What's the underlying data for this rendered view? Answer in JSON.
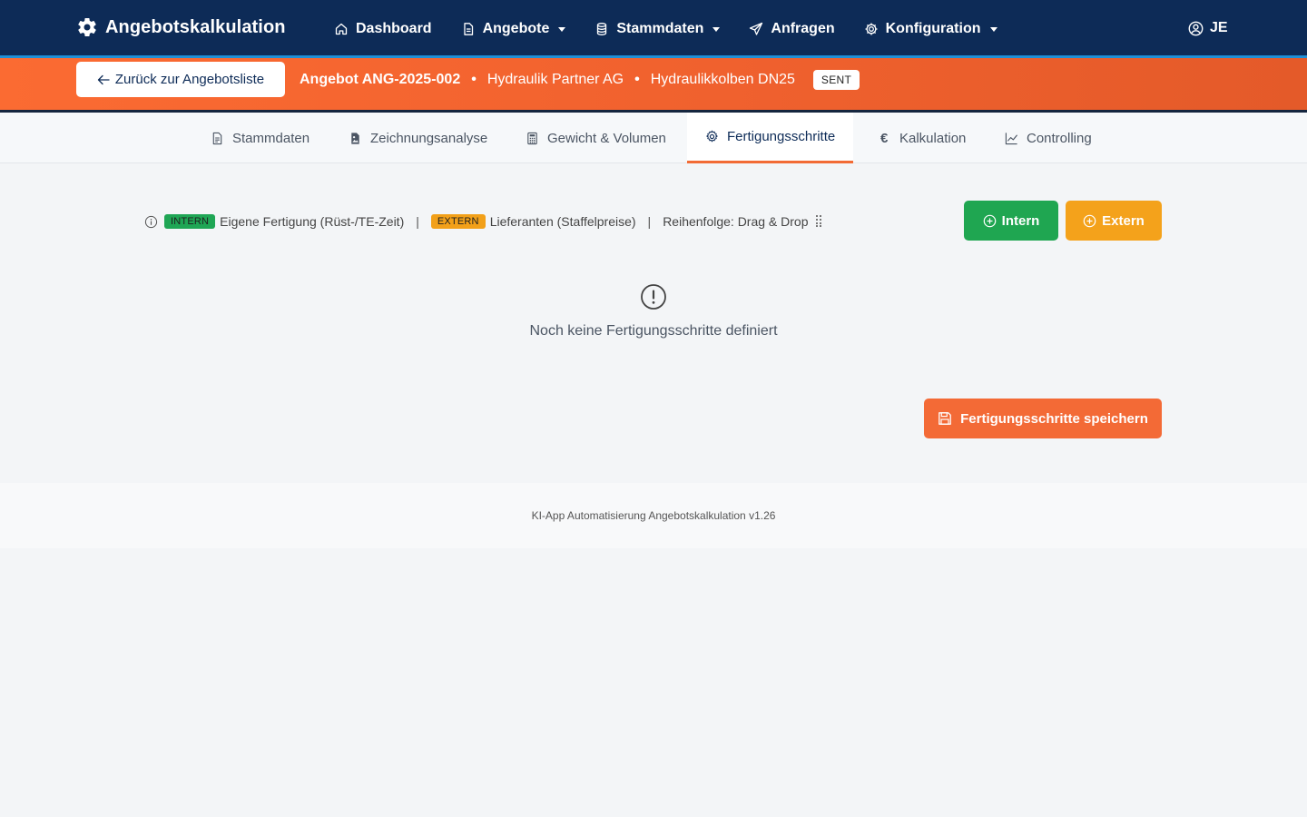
{
  "navbar": {
    "brand": "Angebotskalkulation",
    "items": [
      {
        "label": "Dashboard",
        "icon": "home-icon",
        "dropdown": false
      },
      {
        "label": "Angebote",
        "icon": "document-icon",
        "dropdown": true
      },
      {
        "label": "Stammdaten",
        "icon": "database-icon",
        "dropdown": true
      },
      {
        "label": "Anfragen",
        "icon": "send-icon",
        "dropdown": false
      },
      {
        "label": "Konfiguration",
        "icon": "gear-icon",
        "dropdown": true
      }
    ],
    "user": "JE"
  },
  "context": {
    "back_label": "Zurück zur Angebotsliste",
    "offer": "Angebot ANG-2025-002",
    "customer": "Hydraulik Partner AG",
    "product": "Hydraulikkolben DN25",
    "status": "SENT",
    "separator": "•"
  },
  "tabs": [
    {
      "label": "Stammdaten",
      "icon": "document-icon"
    },
    {
      "label": "Zeichnungsanalyse",
      "icon": "image-file-icon"
    },
    {
      "label": "Gewicht & Volumen",
      "icon": "calculator-icon"
    },
    {
      "label": "Fertigungsschritte",
      "icon": "gear-icon",
      "active": true
    },
    {
      "label": "Kalkulation",
      "icon": "euro-icon",
      "glyph": "€"
    },
    {
      "label": "Controlling",
      "icon": "chart-line-icon"
    }
  ],
  "legend": {
    "intern_badge": "INTERN",
    "intern_text": "Eigene Fertigung (Rüst-/TE-Zeit)",
    "extern_badge": "EXTERN",
    "extern_text": "Lieferanten (Staffelpreise)",
    "order_text": "Reihenfolge: Drag & Drop",
    "divider": "|"
  },
  "buttons": {
    "intern": "Intern",
    "extern": "Extern",
    "save": "Fertigungsschritte speichern"
  },
  "empty_state": {
    "message": "Noch keine Fertigungsschritte definiert"
  },
  "footer": {
    "text": "KI-App Automatisierung Angebotskalkulation v1.26"
  },
  "colors": {
    "navbar": "#0d2b57",
    "accent_orange": "#f36a36",
    "intern_green": "#1fa651",
    "extern_amber": "#f4a21b"
  }
}
